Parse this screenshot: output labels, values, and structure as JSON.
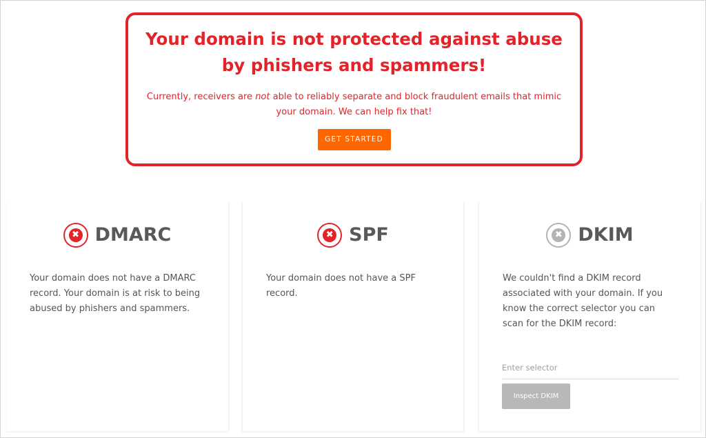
{
  "alert": {
    "title": "Your domain is not protected against abuse by phishers and spammers!",
    "text_before": "Currently, receivers are ",
    "text_emphasis": "not",
    "text_after": " able to reliably separate and block fraudulent emails that mimic your domain. We can help fix that!",
    "button_label": "GET STARTED"
  },
  "cards": {
    "dmarc": {
      "title": "DMARC",
      "status_icon": "x-circle-icon",
      "status": "fail",
      "description": "Your domain does not have a DMARC record. Your domain is at risk to being abused by phishers and spammers."
    },
    "spf": {
      "title": "SPF",
      "status_icon": "x-circle-icon",
      "status": "fail",
      "description": "Your domain does not have a SPF record."
    },
    "dkim": {
      "title": "DKIM",
      "status_icon": "x-circle-icon",
      "status": "unknown",
      "description": "We couldn't find a DKIM record associated with your domain. If you know the correct selector you can scan for the DKIM record:",
      "selector_placeholder": "Enter selector",
      "selector_value": "",
      "button_label": "Inspect DKIM"
    }
  },
  "colors": {
    "alert_red": "#e3232a",
    "cta_orange": "#ff6600",
    "disabled_gray": "#b8b8b8",
    "heading_gray": "#595959"
  },
  "icon_glyphs": {
    "fail": "✖",
    "unknown": "✖"
  }
}
